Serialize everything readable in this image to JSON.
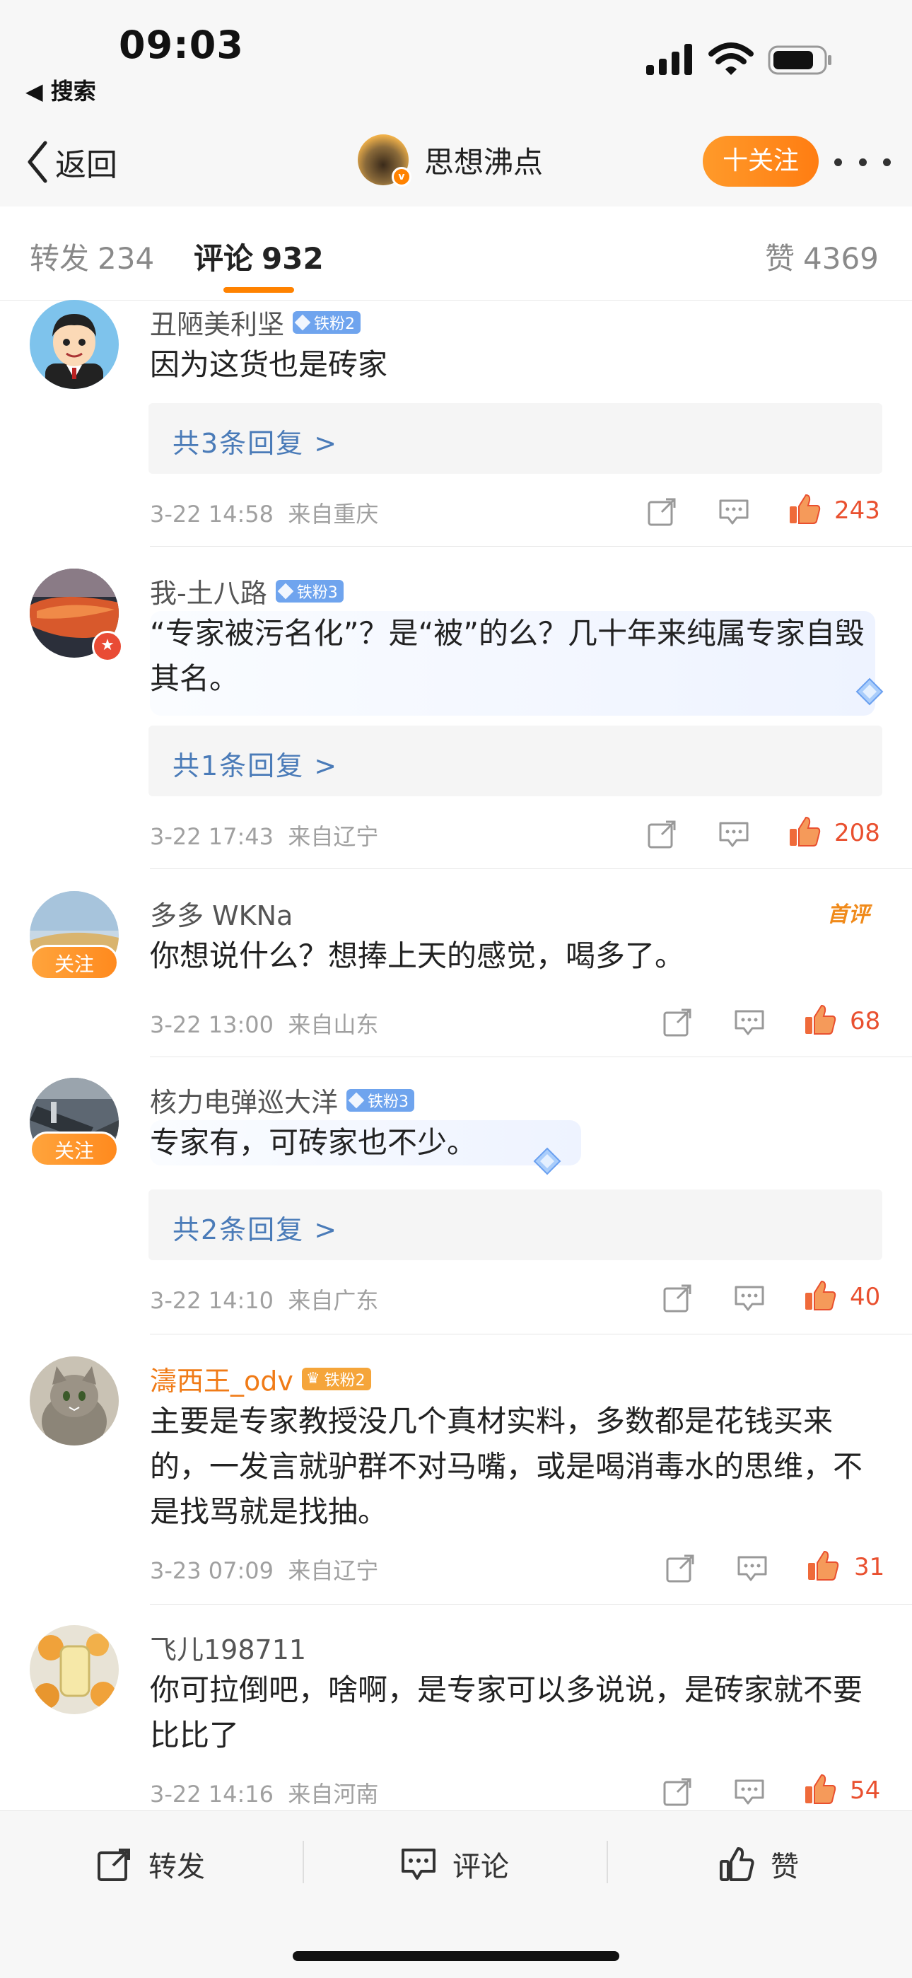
{
  "status": {
    "time": "09:03",
    "back_app": "◀ 搜索"
  },
  "nav": {
    "back_label": "返回",
    "title": "思想沸点",
    "follow_label": "十关注"
  },
  "tabs": {
    "repost": {
      "label": "转发",
      "count": "234"
    },
    "comment": {
      "label": "评论",
      "count": "932"
    },
    "like": {
      "label": "赞",
      "count": "4369"
    }
  },
  "comments": [
    {
      "user": "丑陋美利坚",
      "badge": "铁粉2",
      "text": "因为这货也是砖家",
      "replies": "共3条回复 >",
      "time": "3-22 14:58",
      "location": "来自重庆",
      "likes": "243"
    },
    {
      "user": "我-土八路",
      "badge": "铁粉3",
      "text": "“专家被污名化”？是“被”的么？几十年来纯属专家自毁其名。",
      "replies": "共1条回复 >",
      "time": "3-22 17:43",
      "location": "来自辽宁",
      "likes": "208"
    },
    {
      "user": "多多 WKNa",
      "follow": "关注",
      "first_review": "首评",
      "text": "你想说什么？想捧上天的感觉，喝多了。",
      "time": "3-22 13:00",
      "location": "来自山东",
      "likes": "68"
    },
    {
      "user": "核力电弹巡大洋",
      "badge": "铁粉3",
      "follow": "关注",
      "text": "专家有，可砖家也不少。",
      "replies": "共2条回复 >",
      "time": "3-22 14:10",
      "location": "来自广东",
      "likes": "40"
    },
    {
      "user": "濤西王_odv",
      "badge": "铁粉2",
      "text": "主要是专家教授没几个真材实料，多数都是花钱买来的，一发言就驴群不对马嘴，或是喝消毒水的思维，不是找骂就是找抽。",
      "time": "3-23 07:09",
      "location": "来自辽宁",
      "likes": "31"
    },
    {
      "user": "飞儿198711",
      "text": "你可拉倒吧，啥啊，是专家可以多说说，是砖家就不要比比了",
      "time": "3-22 14:16",
      "location": "来自河南",
      "likes": "54"
    }
  ],
  "bottom": {
    "repost": "转发",
    "comment": "评论",
    "like": "赞"
  },
  "colors": {
    "accent": "#ff8200",
    "reply_blue": "#4a7bb8",
    "like_red": "#e9502f"
  }
}
